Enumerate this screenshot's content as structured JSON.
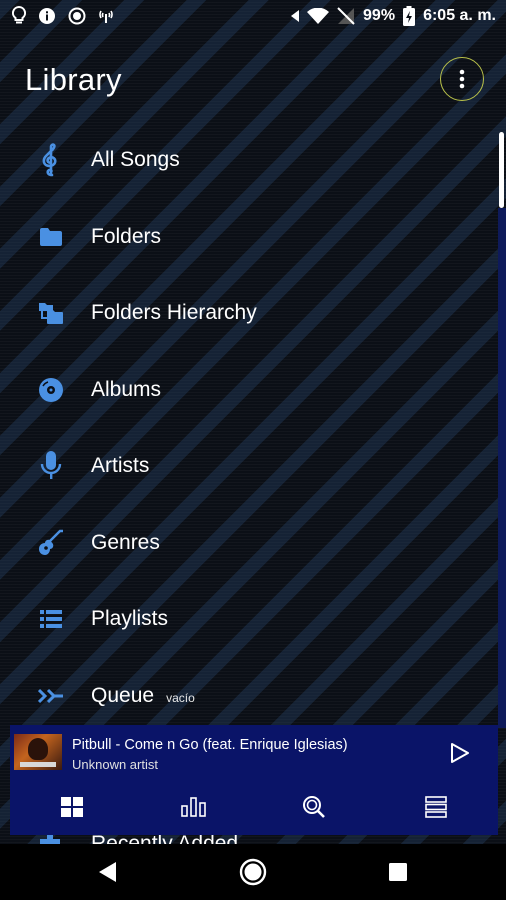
{
  "status": {
    "battery": "99%",
    "time": "6:05 a. m."
  },
  "header": {
    "title": "Library"
  },
  "menu": {
    "items": [
      {
        "label": "All Songs",
        "icon": "treble-clef-icon"
      },
      {
        "label": "Folders",
        "icon": "folder-icon"
      },
      {
        "label": "Folders Hierarchy",
        "icon": "folders-hierarchy-icon"
      },
      {
        "label": "Albums",
        "icon": "album-icon"
      },
      {
        "label": "Artists",
        "icon": "microphone-icon"
      },
      {
        "label": "Genres",
        "icon": "guitar-icon"
      },
      {
        "label": "Playlists",
        "icon": "playlist-icon"
      },
      {
        "label": "Queue",
        "icon": "queue-icon",
        "badge": "vacío"
      }
    ],
    "partial_item": {
      "label": "Recently Added"
    }
  },
  "player": {
    "song": "Pitbull - Come n Go (feat. Enrique Iglesias)",
    "artist": "Unknown artist"
  },
  "colors": {
    "accent_blue": "#4a90e2",
    "player_bg": "#0a1468",
    "focus_ring": "#b9c24a"
  }
}
